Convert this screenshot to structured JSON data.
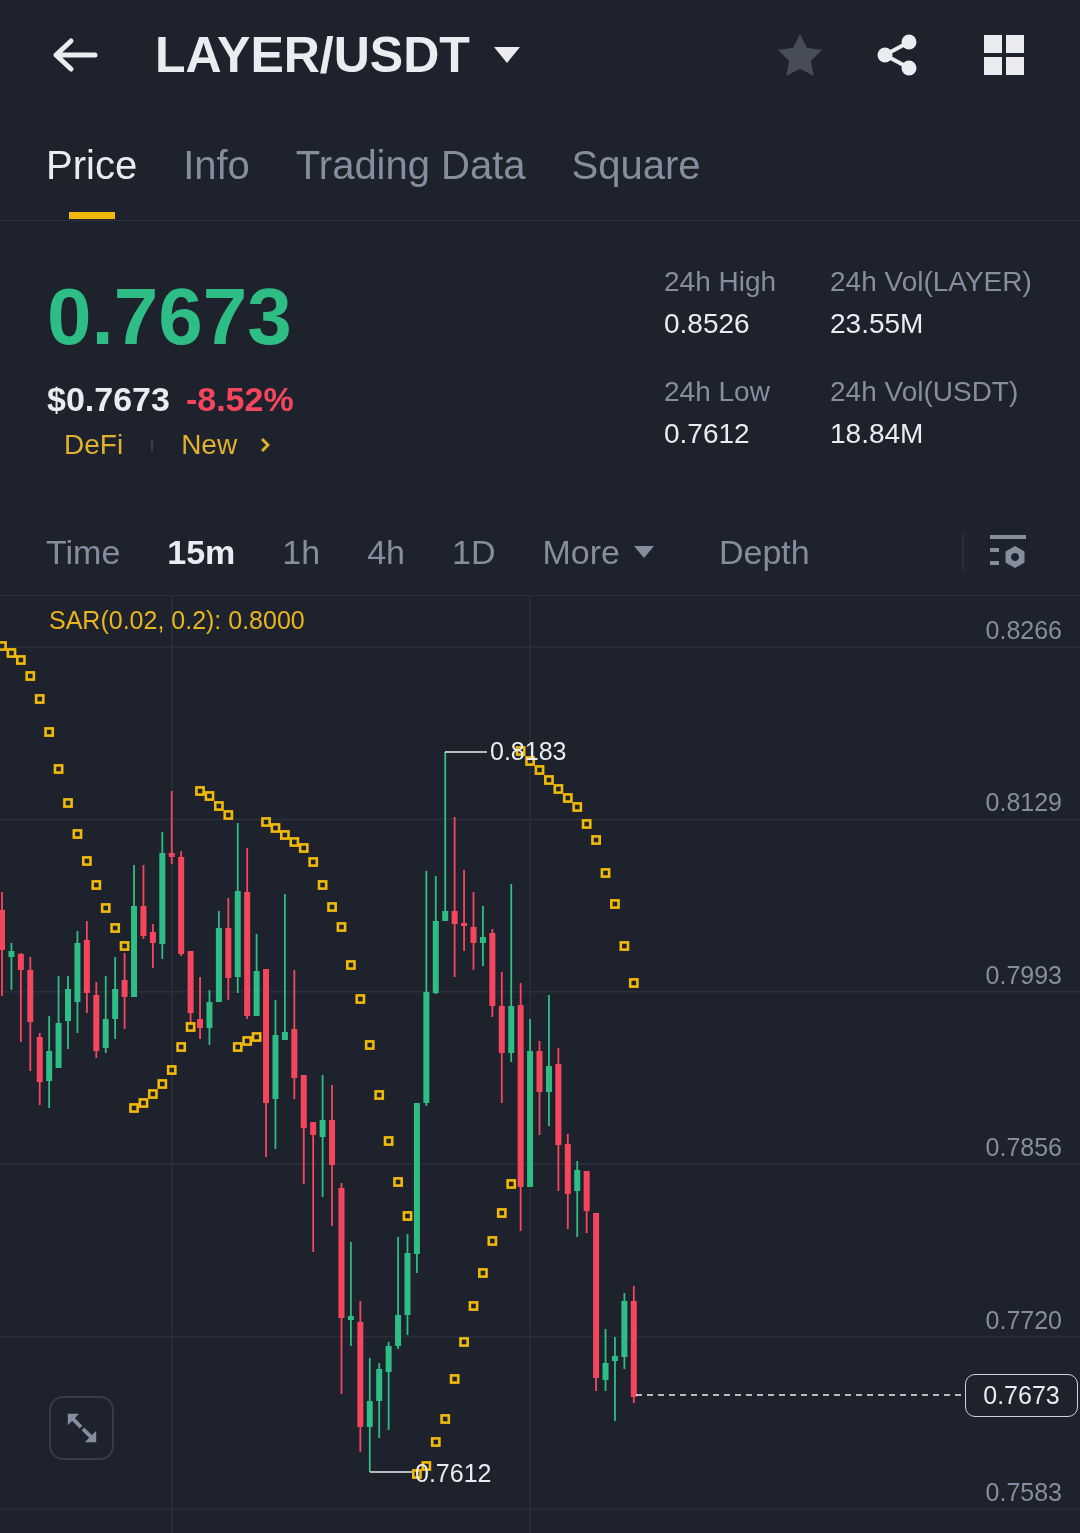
{
  "header": {
    "title": "LAYER/USDT",
    "favorited": false
  },
  "tabs": [
    {
      "label": "Price",
      "selected": true
    },
    {
      "label": "Info",
      "selected": false
    },
    {
      "label": "Trading Data",
      "selected": false
    },
    {
      "label": "Square",
      "selected": false
    }
  ],
  "ticker": {
    "last_price": "0.7673",
    "usd_price": "$0.7673",
    "change": "-8.52%",
    "tags": [
      "DeFi",
      "New"
    ]
  },
  "stats": [
    {
      "label": "24h High",
      "value": "0.8526"
    },
    {
      "label": "24h Vol(LAYER)",
      "value": "23.55M"
    },
    {
      "label": "24h Low",
      "value": "0.7612"
    },
    {
      "label": "24h Vol(USDT)",
      "value": "18.84M"
    }
  ],
  "intervals": [
    {
      "label": "Time",
      "kind": "option",
      "selected": false
    },
    {
      "label": "15m",
      "kind": "option",
      "selected": true
    },
    {
      "label": "1h",
      "kind": "option",
      "selected": false
    },
    {
      "label": "4h",
      "kind": "option",
      "selected": false
    },
    {
      "label": "1D",
      "kind": "option",
      "selected": false
    },
    {
      "label": "More",
      "kind": "dropdown",
      "selected": false
    },
    {
      "label": "Depth",
      "kind": "view",
      "selected": false
    }
  ],
  "chart": {
    "indicator": "SAR(0.02, 0.2): 0.8000",
    "price_ticks": [
      "0.8266",
      "0.8129",
      "0.7993",
      "0.7856",
      "0.7720",
      "0.7583"
    ],
    "high_label": "0.8183",
    "low_label": "0.7612",
    "last_price_tag": "0.7673"
  }
}
